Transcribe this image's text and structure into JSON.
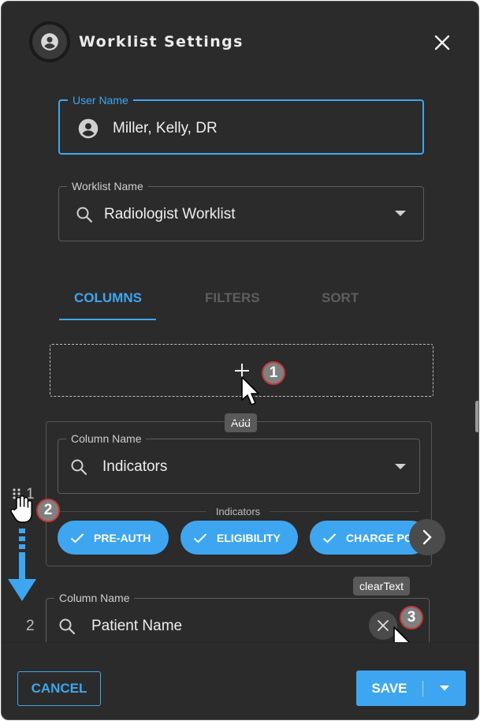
{
  "dialog": {
    "title": "Worklist Settings",
    "close_icon": "close-icon",
    "avatar_icon": "account-circle-icon"
  },
  "user_field": {
    "label": "User Name",
    "value": "Miller, Kelly, DR",
    "icon": "account-circle-icon"
  },
  "worklist_field": {
    "label": "Worklist Name",
    "value": "Radiologist Worklist",
    "icon": "search-icon"
  },
  "tabs": [
    {
      "label": "COLUMNS",
      "active": true
    },
    {
      "label": "FILTERS",
      "active": false
    },
    {
      "label": "SORT",
      "active": false
    }
  ],
  "add_zone": {
    "icon": "plus-icon",
    "tooltip": "Add"
  },
  "columns": [
    {
      "number": "1",
      "label": "Column Name",
      "value": "Indicators",
      "section_label": "Indicators",
      "chips": [
        "PRE-AUTH",
        "ELIGIBILITY",
        "CHARGE POSTED"
      ]
    },
    {
      "number": "2",
      "label": "Column Name",
      "value": "Patient Name",
      "clear_tooltip": "clearText"
    }
  ],
  "annotations": {
    "badges": [
      "1",
      "2",
      "3"
    ]
  },
  "footer": {
    "cancel_label": "CANCEL",
    "save_label": "SAVE"
  },
  "colors": {
    "background": "#2b2b2b",
    "accent": "#3ea6f0",
    "badge": "#808080",
    "badge_border": "#c33838"
  }
}
